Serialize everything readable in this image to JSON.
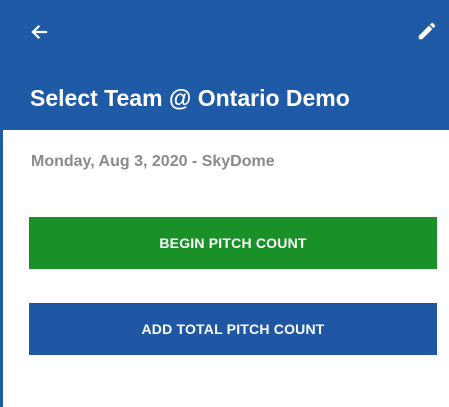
{
  "header": {
    "back_icon": "arrow-left-icon",
    "edit_icon": "pencil-icon",
    "title": "Select Team @ Ontario Demo"
  },
  "event": {
    "subtitle": "Monday, Aug 3, 2020 - SkyDome"
  },
  "actions": {
    "begin_label": "BEGIN PITCH COUNT",
    "add_total_label": "ADD TOTAL PITCH COUNT"
  },
  "colors": {
    "header_bg": "#1f5aa6",
    "begin_button": "#1a9128",
    "add_total_button": "#1f57a4",
    "subtitle_text": "#8a8a8a"
  }
}
